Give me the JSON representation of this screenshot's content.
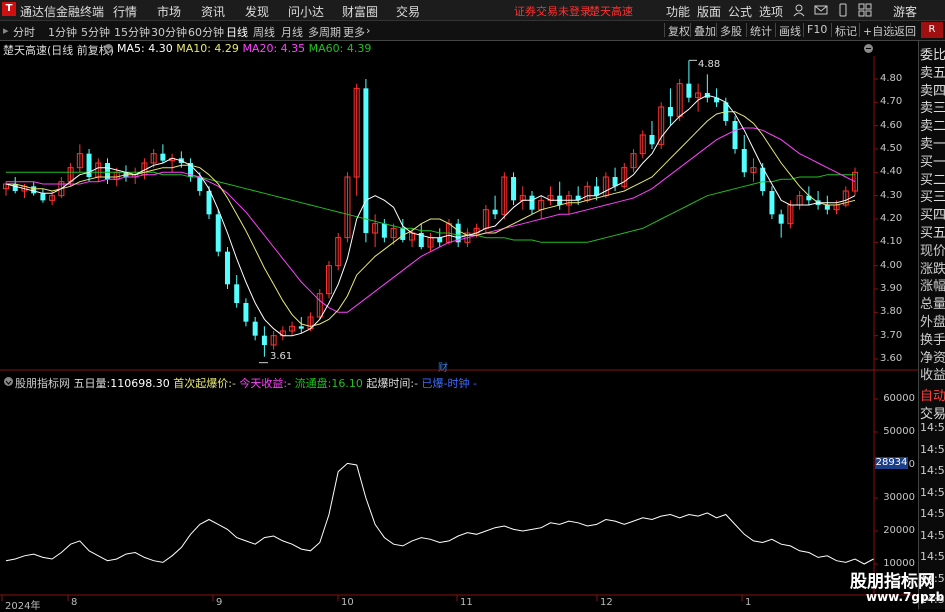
{
  "app": {
    "title": "通达信金融终端",
    "logo_text": "T"
  },
  "menu": [
    "行情",
    "市场",
    "资讯",
    "发现",
    "问小达",
    "财富圈",
    "交易"
  ],
  "warning": {
    "text1": "证券交易未登录",
    "text2": "楚天高速"
  },
  "right_menu": [
    "功能",
    "版面",
    "公式",
    "选项",
    "游客"
  ],
  "toolbar": {
    "periods": [
      "分时",
      "1分钟",
      "5分钟",
      "15分钟",
      "30分钟",
      "60分钟",
      "日线",
      "周线",
      "月线",
      "多周期",
      "更多"
    ],
    "active": "日线",
    "right": [
      "复权",
      "叠加",
      "多股",
      "统计",
      "画线",
      "F10",
      "标记",
      "+自选",
      "返回"
    ]
  },
  "stock": {
    "name": "楚天高速",
    "mode": "(日线 前复权)"
  },
  "ma": {
    "ma5": "MA5: 4.30",
    "ma10": "MA10: 4.29",
    "ma20": "MA20: 4.35",
    "ma60": "MA60: 4.39",
    "colors": {
      "ma5": "#ffffff",
      "ma10": "#e8e870",
      "ma20": "#ff40ff",
      "ma60": "#20c020"
    }
  },
  "price_axis": [
    "4.80",
    "4.70",
    "4.60",
    "4.50",
    "4.40",
    "4.30",
    "4.20",
    "4.10",
    "4.00",
    "3.90",
    "3.80",
    "3.70",
    "3.60"
  ],
  "annotations": {
    "high": "4.88",
    "low": "3.61",
    "cai": "财"
  },
  "indicator": {
    "name": "股朋指标网",
    "five_day_label": "五日量:",
    "five_day_value": "110698.30",
    "first_label": "首次起爆价:",
    "first_value": "-",
    "today_label": "今天收益:",
    "today_value": "-",
    "float_label": "流通盘:",
    "float_value": "16.10",
    "time_label": "起爆时间:",
    "time_value": "-",
    "extra": "已爆-时钟 -"
  },
  "vol_axis": [
    "60000",
    "50000",
    "40000",
    "30000",
    "20000",
    "10000"
  ],
  "vol_current": "28934",
  "x_axis": [
    "2024年",
    "8",
    "9",
    "10",
    "11",
    "12",
    "1"
  ],
  "right_panel": [
    "委比",
    "卖五",
    "卖四",
    "卖三",
    "卖二",
    "卖一",
    "买一",
    "买二",
    "买三",
    "买四",
    "买五",
    "现价",
    "涨跌",
    "涨幅",
    "总量",
    "外盘",
    "换手",
    "净资",
    "收益"
  ],
  "right_panel_bottom": [
    "自动",
    "交易"
  ],
  "times": [
    "14:56",
    "14:56",
    "14:56",
    "14:56",
    "14:56",
    "14:56",
    "14:56",
    "14:56",
    "14:56"
  ],
  "watermark": {
    "line1": "股朋指标网",
    "line2": "www.7gpzb.com"
  },
  "chart_data": {
    "type": "candlestick",
    "ohlc": [
      [
        4.33,
        4.36,
        4.3,
        4.35
      ],
      [
        4.35,
        4.38,
        4.31,
        4.32
      ],
      [
        4.32,
        4.35,
        4.29,
        4.34
      ],
      [
        4.34,
        4.36,
        4.3,
        4.31
      ],
      [
        4.31,
        4.33,
        4.27,
        4.28
      ],
      [
        4.28,
        4.32,
        4.26,
        4.3
      ],
      [
        4.3,
        4.38,
        4.29,
        4.36
      ],
      [
        4.36,
        4.44,
        4.34,
        4.42
      ],
      [
        4.42,
        4.52,
        4.4,
        4.48
      ],
      [
        4.48,
        4.5,
        4.36,
        4.38
      ],
      [
        4.38,
        4.46,
        4.36,
        4.44
      ],
      [
        4.44,
        4.46,
        4.35,
        4.37
      ],
      [
        4.37,
        4.42,
        4.34,
        4.4
      ],
      [
        4.4,
        4.43,
        4.36,
        4.38
      ],
      [
        4.38,
        4.42,
        4.35,
        4.39
      ],
      [
        4.39,
        4.46,
        4.37,
        4.44
      ],
      [
        4.44,
        4.5,
        4.42,
        4.48
      ],
      [
        4.48,
        4.52,
        4.44,
        4.45
      ],
      [
        4.45,
        4.48,
        4.4,
        4.46
      ],
      [
        4.46,
        4.49,
        4.42,
        4.44
      ],
      [
        4.44,
        4.46,
        4.36,
        4.38
      ],
      [
        4.38,
        4.4,
        4.3,
        4.32
      ],
      [
        4.32,
        4.34,
        4.2,
        4.22
      ],
      [
        4.22,
        4.24,
        4.04,
        4.06
      ],
      [
        4.06,
        4.08,
        3.9,
        3.92
      ],
      [
        3.92,
        3.96,
        3.82,
        3.84
      ],
      [
        3.84,
        3.86,
        3.74,
        3.76
      ],
      [
        3.76,
        3.78,
        3.68,
        3.7
      ],
      [
        3.7,
        3.74,
        3.61,
        3.66
      ],
      [
        3.66,
        3.72,
        3.64,
        3.7
      ],
      [
        3.7,
        3.74,
        3.68,
        3.72
      ],
      [
        3.72,
        3.76,
        3.7,
        3.74
      ],
      [
        3.74,
        3.78,
        3.71,
        3.73
      ],
      [
        3.73,
        3.8,
        3.72,
        3.78
      ],
      [
        3.78,
        3.9,
        3.77,
        3.88
      ],
      [
        3.88,
        4.02,
        3.86,
        4.0
      ],
      [
        4.0,
        4.14,
        3.98,
        4.12
      ],
      [
        4.12,
        4.4,
        4.1,
        4.38
      ],
      [
        4.38,
        4.78,
        4.3,
        4.76
      ],
      [
        4.76,
        4.8,
        4.1,
        4.14
      ],
      [
        4.14,
        4.22,
        4.08,
        4.18
      ],
      [
        4.18,
        4.2,
        4.1,
        4.12
      ],
      [
        4.12,
        4.18,
        4.09,
        4.16
      ],
      [
        4.16,
        4.2,
        4.1,
        4.11
      ],
      [
        4.11,
        4.16,
        4.08,
        4.14
      ],
      [
        4.14,
        4.18,
        4.07,
        4.08
      ],
      [
        4.08,
        4.14,
        4.06,
        4.12
      ],
      [
        4.12,
        4.16,
        4.08,
        4.1
      ],
      [
        4.1,
        4.2,
        4.09,
        4.18
      ],
      [
        4.18,
        4.2,
        4.08,
        4.1
      ],
      [
        4.1,
        4.16,
        4.08,
        4.14
      ],
      [
        4.14,
        4.18,
        4.12,
        4.16
      ],
      [
        4.16,
        4.26,
        4.14,
        4.24
      ],
      [
        4.24,
        4.3,
        4.2,
        4.22
      ],
      [
        4.22,
        4.4,
        4.2,
        4.38
      ],
      [
        4.38,
        4.4,
        4.26,
        4.28
      ],
      [
        4.28,
        4.34,
        4.24,
        4.3
      ],
      [
        4.3,
        4.32,
        4.22,
        4.24
      ],
      [
        4.24,
        4.3,
        4.2,
        4.28
      ],
      [
        4.28,
        4.34,
        4.26,
        4.3
      ],
      [
        4.3,
        4.36,
        4.24,
        4.26
      ],
      [
        4.26,
        4.32,
        4.22,
        4.3
      ],
      [
        4.3,
        4.34,
        4.26,
        4.28
      ],
      [
        4.28,
        4.36,
        4.27,
        4.34
      ],
      [
        4.34,
        4.38,
        4.28,
        4.3
      ],
      [
        4.3,
        4.4,
        4.29,
        4.38
      ],
      [
        4.38,
        4.42,
        4.32,
        4.34
      ],
      [
        4.34,
        4.44,
        4.33,
        4.42
      ],
      [
        4.42,
        4.5,
        4.4,
        4.48
      ],
      [
        4.48,
        4.58,
        4.46,
        4.56
      ],
      [
        4.56,
        4.62,
        4.5,
        4.52
      ],
      [
        4.52,
        4.7,
        4.5,
        4.68
      ],
      [
        4.68,
        4.76,
        4.6,
        4.64
      ],
      [
        4.64,
        4.8,
        4.62,
        4.78
      ],
      [
        4.78,
        4.88,
        4.7,
        4.72
      ],
      [
        4.72,
        4.78,
        4.66,
        4.74
      ],
      [
        4.74,
        4.82,
        4.7,
        4.72
      ],
      [
        4.72,
        4.76,
        4.68,
        4.7
      ],
      [
        4.7,
        4.72,
        4.6,
        4.62
      ],
      [
        4.62,
        4.64,
        4.48,
        4.5
      ],
      [
        4.5,
        4.56,
        4.38,
        4.4
      ],
      [
        4.4,
        4.46,
        4.36,
        4.42
      ],
      [
        4.42,
        4.44,
        4.3,
        4.32
      ],
      [
        4.32,
        4.34,
        4.2,
        4.22
      ],
      [
        4.22,
        4.24,
        4.12,
        4.18
      ],
      [
        4.18,
        4.28,
        4.16,
        4.26
      ],
      [
        4.26,
        4.32,
        4.24,
        4.3
      ],
      [
        4.3,
        4.34,
        4.26,
        4.28
      ],
      [
        4.28,
        4.32,
        4.24,
        4.26
      ],
      [
        4.26,
        4.3,
        4.22,
        4.24
      ],
      [
        4.24,
        4.28,
        4.22,
        4.26
      ],
      [
        4.26,
        4.34,
        4.25,
        4.32
      ],
      [
        4.32,
        4.42,
        4.3,
        4.4
      ]
    ],
    "ma5": [
      4.35,
      4.34,
      4.33,
      4.32,
      4.31,
      4.31,
      4.33,
      4.36,
      4.39,
      4.4,
      4.42,
      4.42,
      4.41,
      4.4,
      4.39,
      4.41,
      4.43,
      4.44,
      4.46,
      4.45,
      4.43,
      4.39,
      4.33,
      4.24,
      4.14,
      4.03,
      3.93,
      3.84,
      3.77,
      3.73,
      3.7,
      3.7,
      3.71,
      3.73,
      3.77,
      3.84,
      3.92,
      4.03,
      4.2,
      4.28,
      4.3,
      4.28,
      4.25,
      4.17,
      4.14,
      4.13,
      4.12,
      4.12,
      4.13,
      4.12,
      4.13,
      4.14,
      4.16,
      4.17,
      4.21,
      4.25,
      4.28,
      4.28,
      4.3,
      4.28,
      4.28,
      4.28,
      4.28,
      4.3,
      4.3,
      4.32,
      4.34,
      4.36,
      4.39,
      4.44,
      4.48,
      4.55,
      4.6,
      4.64,
      4.67,
      4.71,
      4.73,
      4.72,
      4.7,
      4.65,
      4.58,
      4.5,
      4.42,
      4.35,
      4.28,
      4.26,
      4.26,
      4.26,
      4.27,
      4.27,
      4.27,
      4.28,
      4.3
    ],
    "ma10": [
      4.35,
      4.35,
      4.34,
      4.33,
      4.33,
      4.32,
      4.33,
      4.34,
      4.36,
      4.37,
      4.38,
      4.38,
      4.38,
      4.39,
      4.39,
      4.4,
      4.41,
      4.42,
      4.42,
      4.43,
      4.43,
      4.42,
      4.39,
      4.35,
      4.29,
      4.22,
      4.15,
      4.07,
      3.99,
      3.92,
      3.85,
      3.79,
      3.75,
      3.74,
      3.75,
      3.77,
      3.81,
      3.87,
      3.96,
      4.0,
      4.04,
      4.07,
      4.1,
      4.13,
      4.15,
      4.18,
      4.2,
      4.2,
      4.18,
      4.15,
      4.13,
      4.13,
      4.14,
      4.14,
      4.16,
      4.18,
      4.2,
      4.22,
      4.24,
      4.25,
      4.26,
      4.27,
      4.27,
      4.28,
      4.29,
      4.3,
      4.31,
      4.32,
      4.34,
      4.36,
      4.38,
      4.42,
      4.46,
      4.5,
      4.54,
      4.58,
      4.62,
      4.65,
      4.66,
      4.66,
      4.64,
      4.61,
      4.56,
      4.5,
      4.44,
      4.39,
      4.34,
      4.3,
      4.27,
      4.26,
      4.26,
      4.27,
      4.28
    ],
    "ma20": [
      4.36,
      4.36,
      4.36,
      4.36,
      4.35,
      4.35,
      4.35,
      4.35,
      4.35,
      4.36,
      4.36,
      4.37,
      4.37,
      4.38,
      4.38,
      4.39,
      4.39,
      4.4,
      4.4,
      4.4,
      4.39,
      4.38,
      4.36,
      4.34,
      4.31,
      4.27,
      4.23,
      4.18,
      4.13,
      4.08,
      4.03,
      3.98,
      3.93,
      3.89,
      3.85,
      3.82,
      3.8,
      3.8,
      3.83,
      3.86,
      3.89,
      3.92,
      3.95,
      3.98,
      4.01,
      4.04,
      4.06,
      4.08,
      4.1,
      4.11,
      4.12,
      4.13,
      4.14,
      4.15,
      4.16,
      4.17,
      4.18,
      4.19,
      4.2,
      4.21,
      4.22,
      4.22,
      4.23,
      4.24,
      4.25,
      4.26,
      4.27,
      4.28,
      4.29,
      4.31,
      4.33,
      4.36,
      4.39,
      4.42,
      4.45,
      4.48,
      4.51,
      4.54,
      4.56,
      4.58,
      4.59,
      4.59,
      4.58,
      4.56,
      4.54,
      4.51,
      4.48,
      4.46,
      4.44,
      4.42,
      4.4,
      4.38,
      4.36
    ],
    "ma60": [
      4.4,
      4.4,
      4.4,
      4.4,
      4.4,
      4.4,
      4.4,
      4.4,
      4.4,
      4.4,
      4.4,
      4.4,
      4.4,
      4.4,
      4.4,
      4.4,
      4.4,
      4.39,
      4.39,
      4.39,
      4.38,
      4.38,
      4.37,
      4.36,
      4.35,
      4.34,
      4.33,
      4.32,
      4.31,
      4.3,
      4.29,
      4.28,
      4.27,
      4.26,
      4.25,
      4.24,
      4.23,
      4.22,
      4.21,
      4.2,
      4.19,
      4.18,
      4.17,
      4.16,
      4.16,
      4.15,
      4.15,
      4.14,
      4.14,
      4.13,
      4.13,
      4.13,
      4.12,
      4.12,
      4.12,
      4.11,
      4.11,
      4.11,
      4.1,
      4.1,
      4.1,
      4.1,
      4.1,
      4.1,
      4.11,
      4.12,
      4.13,
      4.14,
      4.15,
      4.16,
      4.18,
      4.2,
      4.22,
      4.24,
      4.26,
      4.28,
      4.3,
      4.31,
      4.32,
      4.33,
      4.34,
      4.35,
      4.36,
      4.36,
      4.37,
      4.37,
      4.38,
      4.38,
      4.38,
      4.39,
      4.39,
      4.39,
      4.39
    ],
    "volume_line": [
      11000,
      11500,
      12500,
      13000,
      12000,
      11500,
      13500,
      16000,
      17000,
      14000,
      12500,
      11000,
      11500,
      13000,
      13500,
      12000,
      11000,
      10500,
      12500,
      15000,
      19000,
      22000,
      23500,
      22000,
      20500,
      18000,
      17000,
      16000,
      18000,
      18500,
      17000,
      16000,
      14500,
      14000,
      16500,
      25000,
      38000,
      40500,
      40000,
      30000,
      22000,
      18000,
      16000,
      15500,
      17000,
      18000,
      17500,
      16500,
      17000,
      18500,
      19500,
      19000,
      20000,
      21000,
      21500,
      20500,
      20000,
      20500,
      21000,
      22500,
      22000,
      23000,
      22500,
      21500,
      22000,
      23500,
      23000,
      22000,
      23000,
      24000,
      23500,
      24500,
      25000,
      24000,
      25000,
      24500,
      25500,
      24000,
      25000,
      22000,
      19000,
      17000,
      16500,
      17500,
      16000,
      15500,
      14000,
      13500,
      12000,
      12500,
      11000,
      10500,
      11500,
      10000,
      11500
    ]
  }
}
